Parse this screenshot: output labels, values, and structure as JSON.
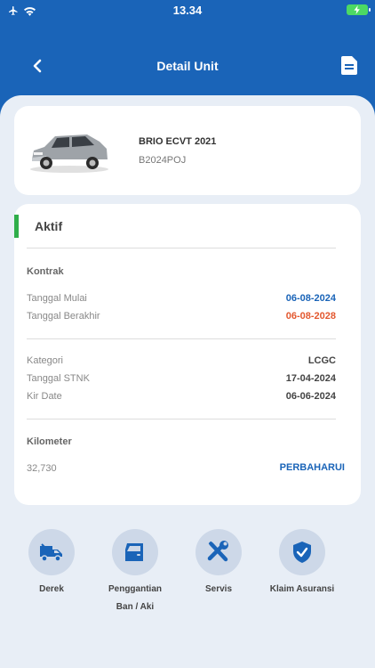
{
  "status_bar": {
    "time": "13.34"
  },
  "nav": {
    "title": "Detail Unit"
  },
  "unit": {
    "name": "BRIO ECVT 2021",
    "plate": "B2024POJ"
  },
  "status": {
    "label": "Aktif",
    "color": "#2fae4a"
  },
  "contract": {
    "title": "Kontrak",
    "start_label": "Tanggal Mulai",
    "start_value": "06-08-2024",
    "end_label": "Tanggal Berakhir",
    "end_value": "06-08-2028"
  },
  "info": {
    "category_label": "Kategori",
    "category_value": "LCGC",
    "stnk_label": "Tanggal STNK",
    "stnk_value": "17-04-2024",
    "kir_label": "Kir Date",
    "kir_value": "06-06-2024"
  },
  "mileage": {
    "title": "Kilometer",
    "value": "32,730",
    "update_label": "PERBAHARUI"
  },
  "actions": [
    {
      "label": "Derek",
      "icon": "tow-truck-icon"
    },
    {
      "label": "Penggantian Ban / Aki",
      "icon": "car-door-icon"
    },
    {
      "label": "Servis",
      "icon": "wrench-screwdriver-icon"
    },
    {
      "label": "Klaim Asuransi",
      "icon": "shield-check-icon"
    }
  ],
  "colors": {
    "primary": "#1a64b8",
    "accent_orange": "#e3582f",
    "background": "#e8eef6"
  }
}
